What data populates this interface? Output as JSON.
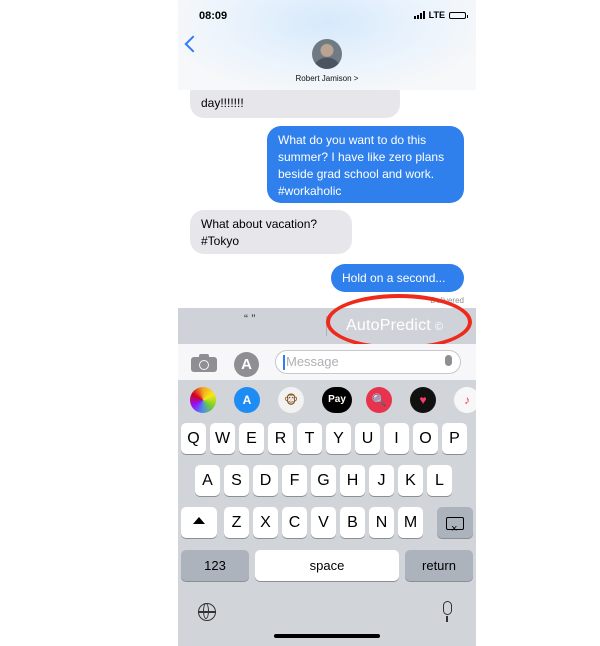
{
  "status_bar": {
    "time": "08:09",
    "network": "LTE"
  },
  "header": {
    "contact_name": "Robert Jamison >"
  },
  "thread": {
    "messages": [
      {
        "from": "contact",
        "text": "day!!!!!!!"
      },
      {
        "from": "me",
        "text": "What do you want to do this summer?  I have like zero plans beside grad school and work. #workaholic"
      },
      {
        "from": "contact",
        "text": "What about vacation? #Tokyo"
      },
      {
        "from": "me",
        "text": "Hold on a second..."
      }
    ],
    "delivered_label": "Delivered"
  },
  "predictive_bar": {
    "quotes": "“ ”",
    "suggestion": "AutoPredict",
    "suggestion_mark": "©",
    "highlight_color": "#ee2a1d"
  },
  "input_row": {
    "placeholder": "Message"
  },
  "app_drawer": {
    "apps": [
      "photos-app-icon",
      "app-store-app-icon",
      "animoji-app-icon",
      "apple-pay-app-icon",
      "search-images-app-icon",
      "digital-touch-app-icon",
      "music-app-icon"
    ],
    "apple_pay_label": "Pay"
  },
  "keyboard": {
    "row1": [
      "Q",
      "W",
      "E",
      "R",
      "T",
      "Y",
      "U",
      "I",
      "O",
      "P"
    ],
    "row2": [
      "A",
      "S",
      "D",
      "F",
      "G",
      "H",
      "J",
      "K",
      "L"
    ],
    "row3": [
      "Z",
      "X",
      "C",
      "V",
      "B",
      "N",
      "M"
    ],
    "numbers_label": "123",
    "space_label": "space",
    "return_label": "return"
  },
  "colors": {
    "accent": "#2f80ed",
    "incoming_bubble": "#e6e6eb",
    "keyboard_bg": "#d1d4d9"
  }
}
